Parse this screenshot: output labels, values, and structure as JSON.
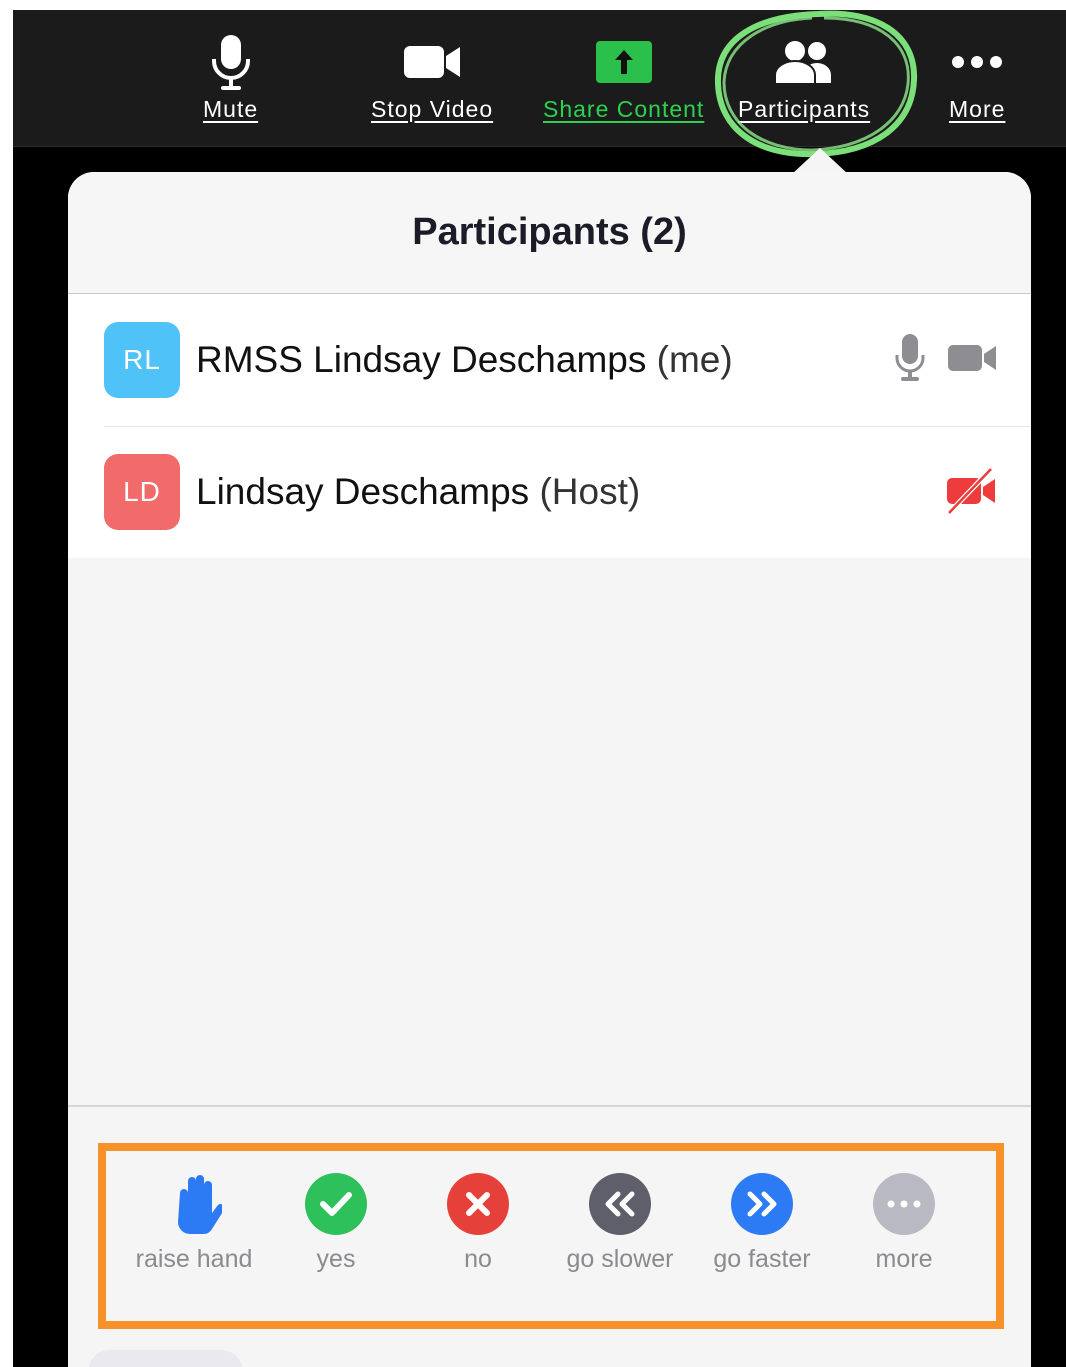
{
  "toolbar": {
    "mute": {
      "label": "Mute",
      "icon": "microphone-icon"
    },
    "stop_video": {
      "label": "Stop Video",
      "icon": "video-camera-icon"
    },
    "share_content": {
      "label": "Share Content",
      "icon": "share-arrow-icon",
      "color": "#2bd24f"
    },
    "participants": {
      "label": "Participants",
      "icon": "participants-icon"
    },
    "more": {
      "label": "More",
      "icon": "ellipsis-icon"
    }
  },
  "annotation_colors": {
    "circle": "#7be07a",
    "box": "#f7922b"
  },
  "panel": {
    "title": "Participants (2)",
    "participants": [
      {
        "initials": "RL",
        "name": "RMSS Lindsay Deschamps",
        "suffix": "(me)",
        "avatar_color": "#4fc3f7",
        "mic": "on",
        "video": "on"
      },
      {
        "initials": "LD",
        "name": "Lindsay Deschamps",
        "suffix": "(Host)",
        "avatar_color": "#f26b6b",
        "video": "off"
      }
    ]
  },
  "reactions": [
    {
      "label": "raise hand",
      "icon": "raised-hand-icon",
      "color": "#2d7bf4"
    },
    {
      "label": "yes",
      "icon": "checkmark-icon",
      "color": "#2ec05a"
    },
    {
      "label": "no",
      "icon": "x-icon",
      "color": "#e5413a"
    },
    {
      "label": "go slower",
      "icon": "double-chevron-left-icon",
      "color": "#5f5f6b"
    },
    {
      "label": "go faster",
      "icon": "double-chevron-right-icon",
      "color": "#2d7bf4"
    },
    {
      "label": "more",
      "icon": "ellipsis-icon",
      "color": "#b9b9c3"
    }
  ]
}
